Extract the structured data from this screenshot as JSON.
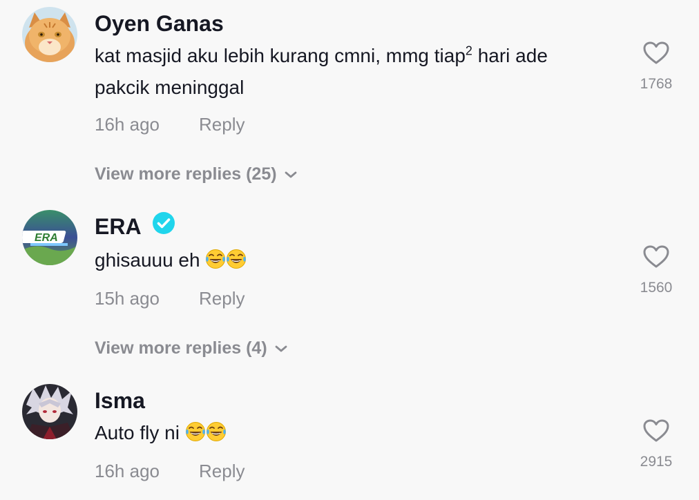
{
  "comments": [
    {
      "username": "Oyen Ganas",
      "text_main": "kat masjid aku lebih kurang cmni, mmg tiap",
      "text_sup": "2",
      "text_tail": " hari ade",
      "text_line2": "pakcik meninggal",
      "time": "16h ago",
      "reply_label": "Reply",
      "likes": "1768",
      "view_more": "View more replies (25)",
      "avatar_icon": "orange-cat-avatar"
    },
    {
      "username": "ERA",
      "verified": true,
      "text": "ghisauuu eh",
      "emoji": "tears-of-joy-emoji",
      "time": "15h ago",
      "reply_label": "Reply",
      "likes": "1560",
      "view_more": "View more replies (4)",
      "avatar_icon": "era-logo-avatar"
    },
    {
      "username": "Isma",
      "text": "Auto fly ni",
      "emoji": "tears-of-joy-emoji",
      "time": "16h ago",
      "reply_label": "Reply",
      "likes": "2915",
      "avatar_icon": "anime-character-avatar"
    }
  ],
  "colors": {
    "background": "#f8f8f8",
    "text": "#161823",
    "muted": "#8a8b91",
    "verified": "#20d5ec"
  }
}
